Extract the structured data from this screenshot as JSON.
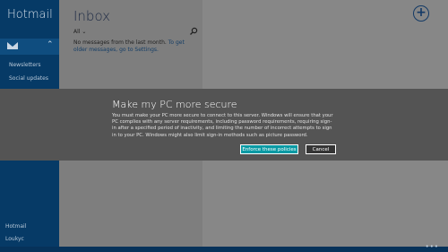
{
  "sidebar": {
    "app_title": "Hotmail",
    "folders": [
      "Newsletters",
      "Social updates"
    ],
    "accounts": [
      "Hotmail",
      "Loukyc"
    ]
  },
  "list": {
    "title": "Inbox",
    "filter": "All",
    "empty_message": "No messages from the last month.",
    "empty_link": "To get older messages, go to Settings."
  },
  "dialog": {
    "title": "Make my PC more secure",
    "body": "You must make your PC more secure to connect to this server. Windows will ensure that your PC complies with any server requirements, including password requirements, requiring sign-in after a specified period of inactivity, and limiting the number of incorrect attempts to sign in to your PC. Windows might also limit sign-in methods such as picture password.",
    "primary_label": "Enforce these policies",
    "cancel_label": "Cancel"
  },
  "colors": {
    "accent_teal": "#0a9aa4",
    "sidebar_blue": "#063a66"
  },
  "icons": [
    "mail-icon",
    "chevron-up-icon",
    "chevron-down-icon",
    "search-icon",
    "new-message-icon"
  ]
}
